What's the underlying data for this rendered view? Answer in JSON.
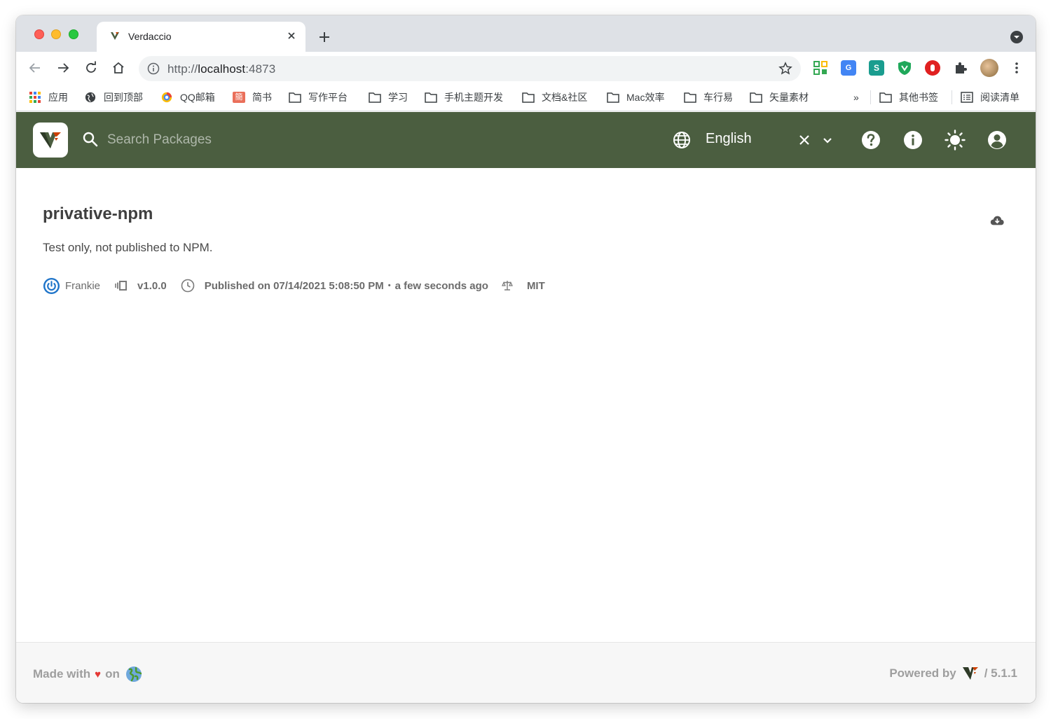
{
  "browser": {
    "tab": {
      "title": "Verdaccio"
    },
    "url": {
      "scheme": "http://",
      "host": "localhost",
      "port": ":4873"
    },
    "bookmarks": [
      {
        "label": "应用",
        "icon": "apps-grid-icon"
      },
      {
        "label": "回到顶部",
        "icon": "globe-icon"
      },
      {
        "label": "QQ邮箱",
        "icon": "qq-mail-icon"
      },
      {
        "label": "简书",
        "icon": "jianshu-icon"
      },
      {
        "label": "写作平台",
        "icon": "folder-icon"
      },
      {
        "label": "学习",
        "icon": "folder-icon"
      },
      {
        "label": "手机主题开发",
        "icon": "folder-icon"
      },
      {
        "label": "文档&社区",
        "icon": "folder-icon"
      },
      {
        "label": "Mac效率",
        "icon": "folder-icon"
      },
      {
        "label": "车行易",
        "icon": "folder-icon"
      },
      {
        "label": "矢量素材",
        "icon": "folder-icon"
      }
    ],
    "bookmarks_overflow": "»",
    "other_bookmarks": "其他书签",
    "reading_list": "阅读清单"
  },
  "app": {
    "search": {
      "placeholder": "Search Packages"
    },
    "language": "English",
    "colors": {
      "header": "#4b5e40",
      "accent": "#1e74c9"
    }
  },
  "package": {
    "name": "privative-npm",
    "description": "Test only, not published to NPM.",
    "author": "Frankie",
    "version": "v1.0.0",
    "published": "Published on 07/14/2021 5:08:50 PM",
    "relative_time": "a few seconds ago",
    "separator": "•",
    "license": "MIT"
  },
  "footer": {
    "made_with": "Made with",
    "heart": "♥",
    "on": "on",
    "powered_by": "Powered by",
    "version": "/ 5.1.1"
  }
}
